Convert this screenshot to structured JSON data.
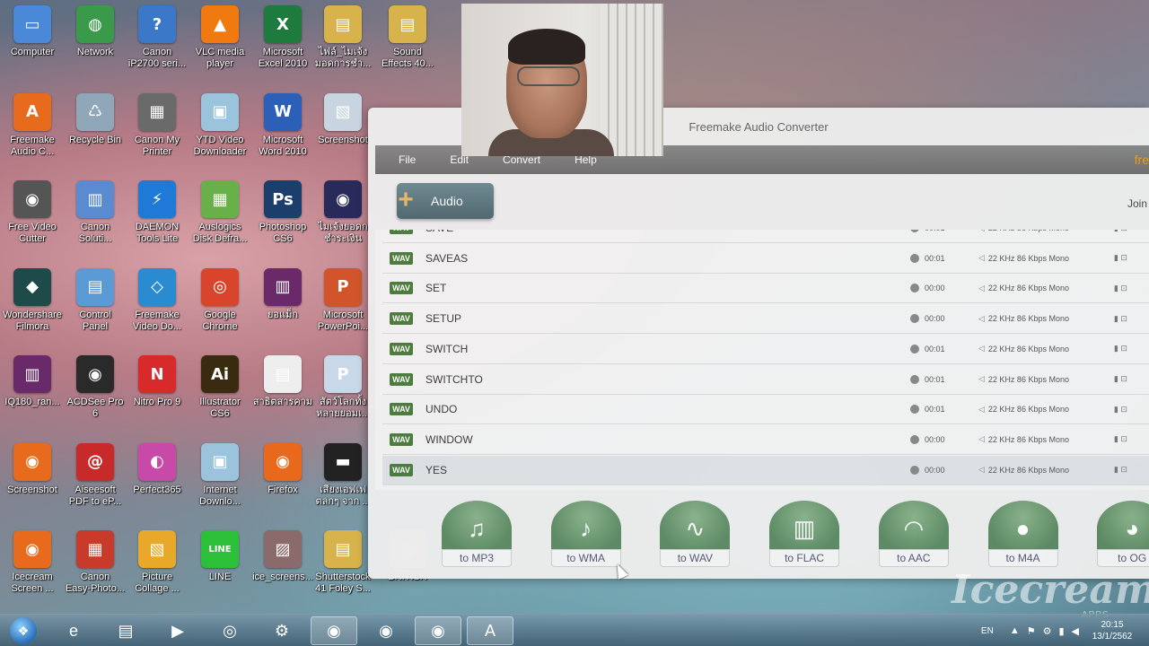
{
  "desktop_icons": [
    {
      "label": "Computer",
      "icon": "computer-icon",
      "color": "#4a88d8",
      "glyph": "▭"
    },
    {
      "label": "Network",
      "icon": "network-icon",
      "color": "#3a9a4a",
      "glyph": "◍"
    },
    {
      "label": "Canon\niP2700 seri...",
      "icon": "printer-help-icon",
      "color": "#3b78c8",
      "glyph": "?"
    },
    {
      "label": "VLC media\nplayer",
      "icon": "vlc-icon",
      "color": "#f07a10",
      "glyph": "▲"
    },
    {
      "label": "Microsoft\nExcel 2010",
      "icon": "excel-icon",
      "color": "#1f7a3e",
      "glyph": "X"
    },
    {
      "label": "ไฟล์_ไมเจ้ง\nมอดการชำ...",
      "icon": "folder-icon",
      "color": "#d8b24a",
      "glyph": "▤"
    },
    {
      "label": "Sound\nEffects 40...",
      "icon": "folder-icon",
      "color": "#d8b24a",
      "glyph": "▤"
    },
    {
      "label": "Freemake\nAudio C...",
      "icon": "freemake-audio-icon",
      "color": "#e86a1c",
      "glyph": "A"
    },
    {
      "label": "Recycle Bin",
      "icon": "recycle-bin-icon",
      "color": "#8fa7b8",
      "glyph": "♺"
    },
    {
      "label": "Canon My\nPrinter",
      "icon": "canon-printer-icon",
      "color": "#6a6a6a",
      "glyph": "▦"
    },
    {
      "label": "YTD Video\nDownloader",
      "icon": "ytd-icon",
      "color": "#9bc4dc",
      "glyph": "▣"
    },
    {
      "label": "Microsoft\nWord 2010",
      "icon": "word-icon",
      "color": "#2b5fb8",
      "glyph": "W"
    },
    {
      "label": "Screenshot",
      "icon": "screenshot-file-icon",
      "color": "#c8d4e0",
      "glyph": "▧"
    },
    {
      "label": "Free Video\nCutter",
      "icon": "film-reel-icon",
      "color": "#555555",
      "glyph": "◉"
    },
    {
      "label": "Canon\nSoluti...",
      "icon": "canon-solution-icon",
      "color": "#5a8ad0",
      "glyph": "▥"
    },
    {
      "label": "DAEMON\nTools Lite",
      "icon": "daemon-tools-icon",
      "color": "#1e7ad6",
      "glyph": "⚡"
    },
    {
      "label": "Auslogics\nDisk Defra...",
      "icon": "auslogics-icon",
      "color": "#6ab04a",
      "glyph": "▦"
    },
    {
      "label": "Photoshop\nCS6",
      "icon": "photoshop-icon",
      "color": "#1b3e6a",
      "glyph": "Ps"
    },
    {
      "label": "ไมเจ้งยอดก\nชำระเงิน",
      "icon": "firefox-doc-icon",
      "color": "#2a2a5a",
      "glyph": "◉"
    },
    {
      "label": "Wondershare\nFilmora",
      "icon": "filmora-icon",
      "color": "#1f4a4a",
      "glyph": "◆"
    },
    {
      "label": "Control\nPanel",
      "icon": "control-panel-icon",
      "color": "#5b9bd5",
      "glyph": "▤"
    },
    {
      "label": "Freemake\nVideo Do...",
      "icon": "freemake-video-icon",
      "color": "#2a8bd0",
      "glyph": "◇"
    },
    {
      "label": "Google\nChrome",
      "icon": "chrome-icon",
      "color": "#d9442c",
      "glyph": "◎"
    },
    {
      "label": "ยอแม็ก",
      "icon": "winrar-icon",
      "color": "#6a2a6a",
      "glyph": "▥"
    },
    {
      "label": "Microsoft\nPowerPoi...",
      "icon": "powerpoint-icon",
      "color": "#d2542a",
      "glyph": "P"
    },
    {
      "label": "IQ180_ran...",
      "icon": "winrar-icon",
      "color": "#6a2a6a",
      "glyph": "▥"
    },
    {
      "label": "ACDSee Pro\n6",
      "icon": "acdsee-icon",
      "color": "#2a2a2a",
      "glyph": "◉"
    },
    {
      "label": "Nitro Pro 9",
      "icon": "nitro-icon",
      "color": "#d82a2a",
      "glyph": "N"
    },
    {
      "label": "Illustrator\nCS6",
      "icon": "illustrator-icon",
      "color": "#3a2a10",
      "glyph": "Ai"
    },
    {
      "label": "สาธิตสารคาม",
      "icon": "document-icon",
      "color": "#eeeeee",
      "glyph": "▤"
    },
    {
      "label": "สัตว์โลกทั้ง\nหลายยอมเ...",
      "icon": "ppt-file-icon",
      "color": "#c8d8e8",
      "glyph": "P"
    },
    {
      "label": "Screenshot",
      "icon": "screenshot-app-icon",
      "color": "#e86a1c",
      "glyph": "◉"
    },
    {
      "label": "Aiseesoft\nPDF to eP...",
      "icon": "aiseesoft-icon",
      "color": "#c82a2a",
      "glyph": "@"
    },
    {
      "label": "Perfect365",
      "icon": "perfect365-icon",
      "color": "#c84aa8",
      "glyph": "◐"
    },
    {
      "label": "Internet\nDownlo...",
      "icon": "idm-icon",
      "color": "#9bc4dc",
      "glyph": "▣"
    },
    {
      "label": "Firefox",
      "icon": "firefox-icon",
      "color": "#e8681c",
      "glyph": "◉"
    },
    {
      "label": "เสียงเอฟเฟ\nตลกๆ จาก ...",
      "icon": "video-file-icon",
      "color": "#222222",
      "glyph": "▬"
    },
    {
      "label": "Icecream\nScreen ...",
      "icon": "icecream-icon",
      "color": "#e86a1c",
      "glyph": "◉"
    },
    {
      "label": "Canon\nEasy-Photo...",
      "icon": "canon-easyphoto-icon",
      "color": "#c83a2a",
      "glyph": "▦"
    },
    {
      "label": "Picture\nCollage ...",
      "icon": "picture-collage-icon",
      "color": "#e8a82a",
      "glyph": "▧"
    },
    {
      "label": "LINE",
      "icon": "line-icon",
      "color": "#2bbf3a",
      "glyph": "LINE"
    },
    {
      "label": "ice_screens...",
      "icon": "image-file-icon",
      "color": "#8a6a6a",
      "glyph": "▨"
    },
    {
      "label": "Shutterstock\n41 Foley S...",
      "icon": "folder-icon",
      "color": "#d8b24a",
      "glyph": "▤"
    },
    {
      "label": "BRITISH",
      "icon": "folder-icon",
      "color": "#bcbcbc",
      "glyph": "▤"
    }
  ],
  "app": {
    "title": "Freemake Audio Converter",
    "menu": [
      "File",
      "Edit",
      "Convert",
      "Help"
    ],
    "logo_partial": "fre",
    "audio_button": "Audio",
    "join_text": "Join",
    "files": [
      {
        "name": "SAVE",
        "dur": "00:01",
        "info": "22 KHz  86 Kbps  Mono",
        "partial": true
      },
      {
        "name": "SAVEAS",
        "dur": "00:01",
        "info": "22 KHz  86 Kbps  Mono"
      },
      {
        "name": "SET",
        "dur": "00:00",
        "info": "22 KHz  86 Kbps  Mono"
      },
      {
        "name": "SETUP",
        "dur": "00:00",
        "info": "22 KHz  86 Kbps  Mono"
      },
      {
        "name": "SWITCH",
        "dur": "00:01",
        "info": "22 KHz  86 Kbps  Mono"
      },
      {
        "name": "SWITCHTO",
        "dur": "00:01",
        "info": "22 KHz  86 Kbps  Mono"
      },
      {
        "name": "UNDO",
        "dur": "00:01",
        "info": "22 KHz  86 Kbps  Mono"
      },
      {
        "name": "WINDOW",
        "dur": "00:00",
        "info": "22 KHz  86 Kbps  Mono"
      },
      {
        "name": "YES",
        "dur": "00:00",
        "info": "22 KHz  86 Kbps  Mono",
        "selected": true
      }
    ],
    "badge": "WAV",
    "convert_buttons": [
      {
        "label": "to MP3",
        "icon": "earphones-icon",
        "glyph": "♫"
      },
      {
        "label": "to WMA",
        "icon": "wma-icon",
        "glyph": "♪"
      },
      {
        "label": "to WAV",
        "icon": "waveform-icon",
        "glyph": "∿"
      },
      {
        "label": "to FLAC",
        "icon": "equalizer-icon",
        "glyph": "▥"
      },
      {
        "label": "to AAC",
        "icon": "aac-icon",
        "glyph": "◠"
      },
      {
        "label": "to M4A",
        "icon": "apple-icon",
        "glyph": "●"
      },
      {
        "label": "to OG",
        "icon": "ogg-fish-icon",
        "glyph": "◕"
      }
    ]
  },
  "watermark": {
    "text": "Icecream",
    "sub": "APPS"
  },
  "taskbar": {
    "items": [
      {
        "icon": "ie-icon",
        "glyph": "e"
      },
      {
        "icon": "explorer-icon",
        "glyph": "▤"
      },
      {
        "icon": "media-player-icon",
        "glyph": "▶"
      },
      {
        "icon": "chrome-icon",
        "glyph": "◎"
      },
      {
        "icon": "daemon-taskbar-icon",
        "glyph": "⚙"
      },
      {
        "icon": "icecream-recorder-icon",
        "glyph": "◉",
        "active": true
      },
      {
        "icon": "screenshot-taskbar-icon",
        "glyph": "◉"
      },
      {
        "icon": "firefox-icon",
        "glyph": "◉",
        "active": true
      },
      {
        "icon": "freemake-audio-taskbar-icon",
        "glyph": "A",
        "active": true
      }
    ],
    "lang": "EN",
    "time": "20:15",
    "date": "13/1/2562"
  }
}
